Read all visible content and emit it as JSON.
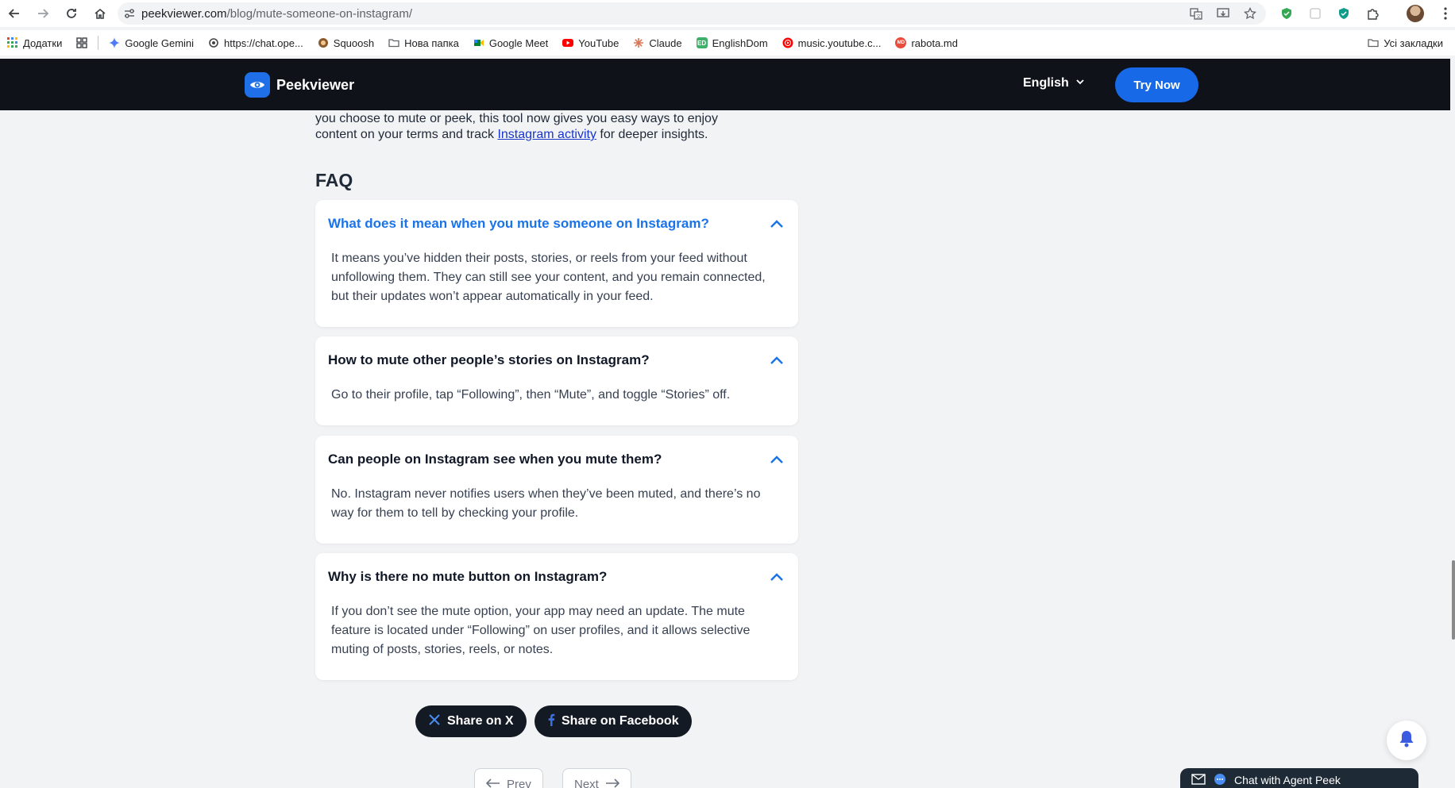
{
  "browser": {
    "url_host": "peekviewer.com",
    "url_path": "/blog/mute-someone-on-instagram/"
  },
  "bookmarks": {
    "items": [
      {
        "label": "Додатки",
        "icon": "apps-grid-icon"
      },
      {
        "label": "Google Gemini",
        "icon": "gemini-icon"
      },
      {
        "label": "https://chat.ope...",
        "icon": "openai-icon"
      },
      {
        "label": "Squoosh",
        "icon": "squoosh-icon"
      },
      {
        "label": "Нова папка",
        "icon": "folder-icon"
      },
      {
        "label": "Google Meet",
        "icon": "meet-icon"
      },
      {
        "label": "YouTube",
        "icon": "youtube-icon"
      },
      {
        "label": "Claude",
        "icon": "claude-icon"
      },
      {
        "label": "EnglishDom",
        "icon": "englishdom-icon"
      },
      {
        "label": "music.youtube.c...",
        "icon": "youtube-music-icon"
      },
      {
        "label": "rabota.md",
        "icon": "rabota-icon"
      }
    ],
    "all_bookmarks": "Усі закладки"
  },
  "header": {
    "brand": "Peekviewer",
    "language": "English",
    "cta": "Try Now"
  },
  "article": {
    "intro_line1": "you choose to mute or peek, this tool now gives you easy ways to enjoy",
    "intro_line2_before": "content on your terms and track ",
    "intro_link": "Instagram activity",
    "intro_line2_after": " for deeper insights.",
    "faq_title": "FAQ",
    "faq": [
      {
        "question": "What does it mean when you mute someone on Instagram?",
        "answer": "It means you’ve hidden their posts, stories, or reels from your feed without unfollowing them. They can still see your content, and you remain connected, but their updates won’t appear automatically in your feed."
      },
      {
        "question": "How to mute other people’s stories on Instagram?",
        "answer": "Go to their profile, tap “Following”, then “Mute”, and toggle “Stories” off."
      },
      {
        "question": "Can people on Instagram see when you mute them?",
        "answer": "No. Instagram never notifies users when they’ve been muted, and there’s no way for them to tell by checking your profile."
      },
      {
        "question": "Why is there no mute button on Instagram?",
        "answer": "If you don’t see the mute option, your app may need an update. The mute feature is located under “Following” on user profiles, and it allows selective muting of posts, stories, reels, or notes."
      }
    ],
    "share_x": "Share on X",
    "share_facebook": "Share on Facebook",
    "prev": "Prev",
    "next": "Next"
  },
  "chat_widget": {
    "label": "Chat with Agent Peek"
  },
  "colors": {
    "header_bg": "#0f1218",
    "accent": "#1769e8",
    "open_question": "#1a73e8",
    "link": "#1a36c9"
  }
}
